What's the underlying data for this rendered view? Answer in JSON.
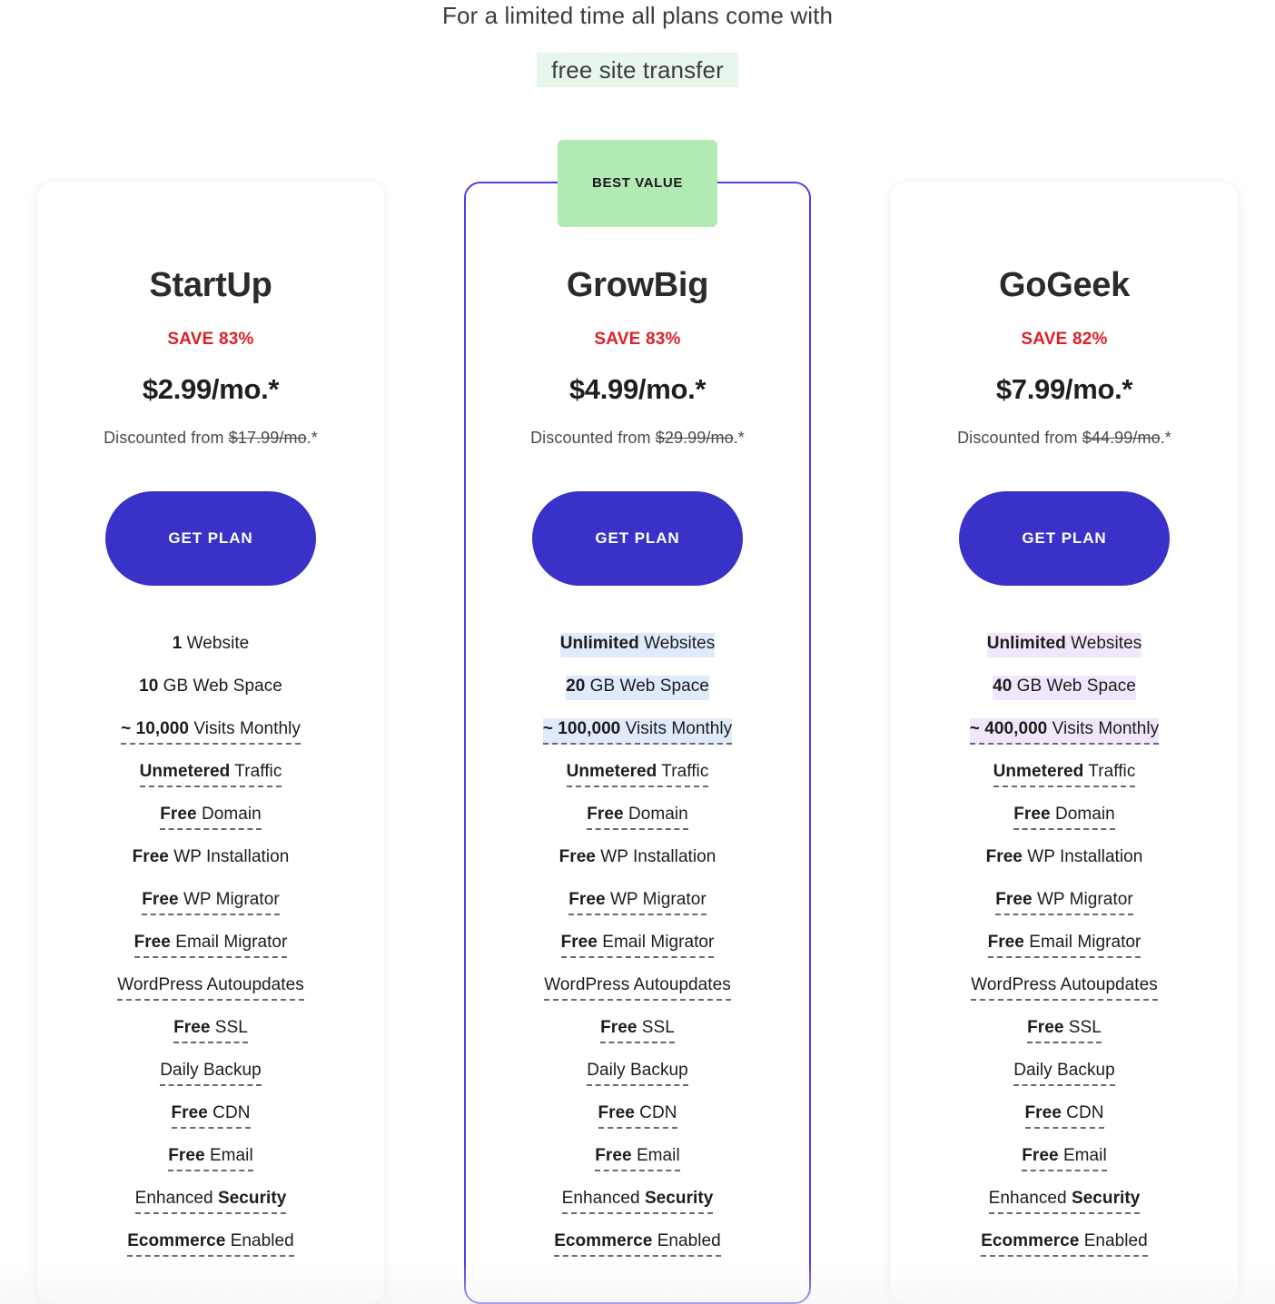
{
  "promo": {
    "line1": "For a limited time all plans come with",
    "badge": "free site transfer"
  },
  "colors": {
    "accent_button": "#3a32c8",
    "featured_border": "#4b3fe4",
    "badge_green": "#b2eab4",
    "save_red": "#e01f26",
    "highlight_blue": "#dfeafa",
    "highlight_purple": "#f1e6fb"
  },
  "plans": [
    {
      "name": "StartUp",
      "save": "SAVE 83%",
      "price": "$2.99/mo.*",
      "discount_prefix": "Discounted from ",
      "discount_struck": "$17.99/mo",
      "discount_suffix": ".*",
      "cta": "GET PLAN",
      "featured": false,
      "badge": "",
      "features": [
        {
          "bold": "1",
          "rest": " Website",
          "dashed": false,
          "highlight": ""
        },
        {
          "bold": "10",
          "rest": " GB Web Space",
          "dashed": false,
          "highlight": ""
        },
        {
          "bold": "~ 10,000",
          "rest": " Visits Monthly",
          "dashed": true,
          "highlight": ""
        },
        {
          "bold": "Unmetered",
          "rest": " Traffic",
          "dashed": true,
          "highlight": ""
        },
        {
          "bold": "Free",
          "rest": " Domain",
          "dashed": true,
          "highlight": ""
        },
        {
          "bold": "Free",
          "rest": " WP Installation",
          "dashed": false,
          "highlight": ""
        },
        {
          "bold": "Free",
          "rest": " WP Migrator",
          "dashed": true,
          "highlight": ""
        },
        {
          "bold": "Free",
          "rest": " Email Migrator",
          "dashed": true,
          "highlight": ""
        },
        {
          "bold": "",
          "rest": "WordPress Autoupdates",
          "dashed": true,
          "highlight": ""
        },
        {
          "bold": "Free",
          "rest": " SSL",
          "dashed": true,
          "highlight": ""
        },
        {
          "bold": "",
          "rest": "Daily Backup",
          "dashed": true,
          "highlight": ""
        },
        {
          "bold": "Free",
          "rest": " CDN",
          "dashed": true,
          "highlight": ""
        },
        {
          "bold": "Free",
          "rest": " Email",
          "dashed": true,
          "highlight": ""
        },
        {
          "bold": "",
          "rest": "Enhanced ",
          "bold_after": "Security",
          "dashed": true,
          "highlight": ""
        },
        {
          "bold": "Ecommerce",
          "rest": " Enabled",
          "dashed": true,
          "highlight": ""
        }
      ]
    },
    {
      "name": "GrowBig",
      "save": "SAVE 83%",
      "price": "$4.99/mo.*",
      "discount_prefix": "Discounted from ",
      "discount_struck": "$29.99/mo",
      "discount_suffix": ".*",
      "cta": "GET PLAN",
      "featured": true,
      "badge": "BEST VALUE",
      "features": [
        {
          "bold": "Unlimited",
          "rest": " Websites",
          "dashed": false,
          "highlight": "blue"
        },
        {
          "bold": "20",
          "rest": " GB Web Space",
          "dashed": false,
          "highlight": "blue"
        },
        {
          "bold": "~ 100,000",
          "rest": " Visits Monthly",
          "dashed": true,
          "highlight": "blue"
        },
        {
          "bold": "Unmetered",
          "rest": " Traffic",
          "dashed": true,
          "highlight": ""
        },
        {
          "bold": "Free",
          "rest": " Domain",
          "dashed": true,
          "highlight": ""
        },
        {
          "bold": "Free",
          "rest": " WP Installation",
          "dashed": false,
          "highlight": ""
        },
        {
          "bold": "Free",
          "rest": " WP Migrator",
          "dashed": true,
          "highlight": ""
        },
        {
          "bold": "Free",
          "rest": " Email Migrator",
          "dashed": true,
          "highlight": ""
        },
        {
          "bold": "",
          "rest": "WordPress Autoupdates",
          "dashed": true,
          "highlight": ""
        },
        {
          "bold": "Free",
          "rest": " SSL",
          "dashed": true,
          "highlight": ""
        },
        {
          "bold": "",
          "rest": "Daily Backup",
          "dashed": true,
          "highlight": ""
        },
        {
          "bold": "Free",
          "rest": " CDN",
          "dashed": true,
          "highlight": ""
        },
        {
          "bold": "Free",
          "rest": " Email",
          "dashed": true,
          "highlight": ""
        },
        {
          "bold": "",
          "rest": "Enhanced ",
          "bold_after": "Security",
          "dashed": true,
          "highlight": ""
        },
        {
          "bold": "Ecommerce",
          "rest": " Enabled",
          "dashed": true,
          "highlight": ""
        }
      ]
    },
    {
      "name": "GoGeek",
      "save": "SAVE 82%",
      "price": "$7.99/mo.*",
      "discount_prefix": "Discounted from ",
      "discount_struck": "$44.99/mo",
      "discount_suffix": ".*",
      "cta": "GET PLAN",
      "featured": false,
      "badge": "",
      "features": [
        {
          "bold": "Unlimited",
          "rest": " Websites",
          "dashed": false,
          "highlight": "purple"
        },
        {
          "bold": "40",
          "rest": " GB Web Space",
          "dashed": false,
          "highlight": "purple"
        },
        {
          "bold": "~ 400,000",
          "rest": " Visits Monthly",
          "dashed": true,
          "highlight": "purple"
        },
        {
          "bold": "Unmetered",
          "rest": " Traffic",
          "dashed": true,
          "highlight": ""
        },
        {
          "bold": "Free",
          "rest": " Domain",
          "dashed": true,
          "highlight": ""
        },
        {
          "bold": "Free",
          "rest": " WP Installation",
          "dashed": false,
          "highlight": ""
        },
        {
          "bold": "Free",
          "rest": " WP Migrator",
          "dashed": true,
          "highlight": ""
        },
        {
          "bold": "Free",
          "rest": " Email Migrator",
          "dashed": true,
          "highlight": ""
        },
        {
          "bold": "",
          "rest": "WordPress Autoupdates",
          "dashed": true,
          "highlight": ""
        },
        {
          "bold": "Free",
          "rest": " SSL",
          "dashed": true,
          "highlight": ""
        },
        {
          "bold": "",
          "rest": "Daily Backup",
          "dashed": true,
          "highlight": ""
        },
        {
          "bold": "Free",
          "rest": " CDN",
          "dashed": true,
          "highlight": ""
        },
        {
          "bold": "Free",
          "rest": " Email",
          "dashed": true,
          "highlight": ""
        },
        {
          "bold": "",
          "rest": "Enhanced ",
          "bold_after": "Security",
          "dashed": true,
          "highlight": ""
        },
        {
          "bold": "Ecommerce",
          "rest": " Enabled",
          "dashed": true,
          "highlight": ""
        }
      ]
    }
  ]
}
